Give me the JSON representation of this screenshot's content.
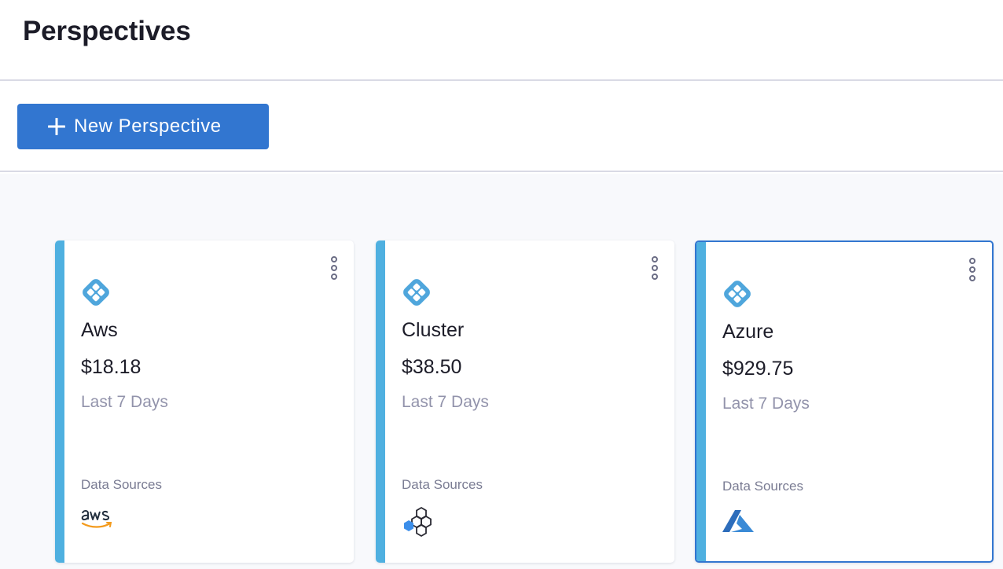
{
  "page": {
    "title": "Perspectives"
  },
  "toolbar": {
    "new_label": "New Perspective"
  },
  "cards": [
    {
      "name": "Aws",
      "cost": "$18.18",
      "period": "Last 7 Days",
      "data_sources_label": "Data Sources",
      "source_icon": "aws-logo-icon",
      "selected": false
    },
    {
      "name": "Cluster",
      "cost": "$38.50",
      "period": "Last 7 Days",
      "data_sources_label": "Data Sources",
      "source_icon": "cluster-hexagon-icon",
      "selected": false
    },
    {
      "name": "Azure",
      "cost": "$929.75",
      "period": "Last 7 Days",
      "data_sources_label": "Data Sources",
      "source_icon": "azure-logo-icon",
      "selected": true
    }
  ],
  "colors": {
    "accent": "#4fb0e0",
    "primary": "#3276d0"
  }
}
